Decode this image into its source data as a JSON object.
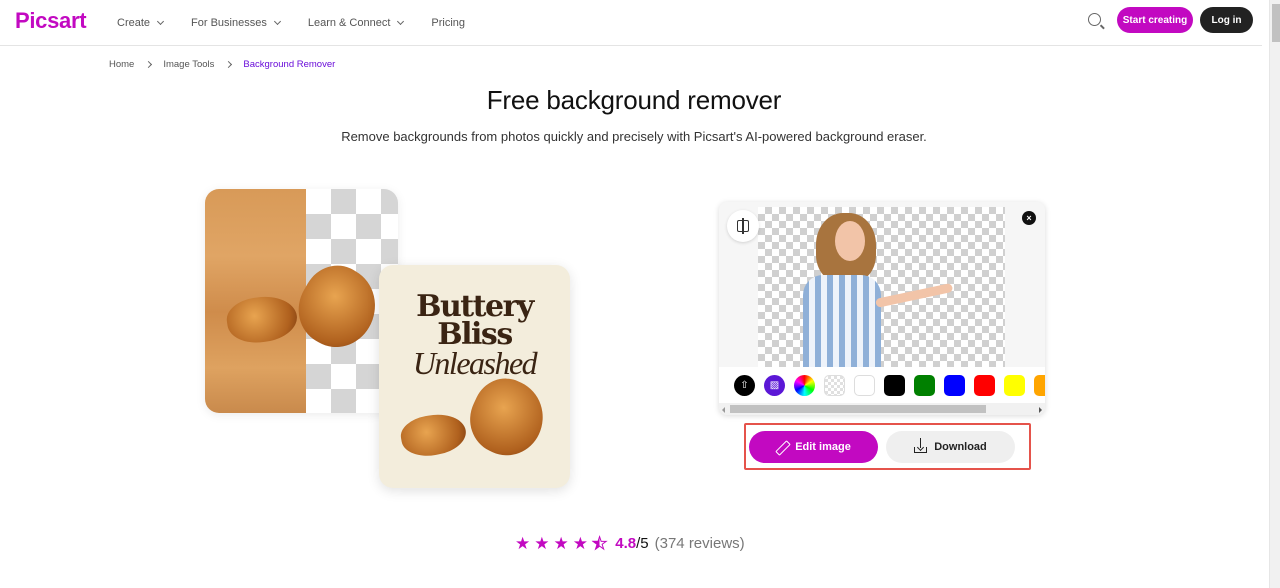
{
  "header": {
    "logo": "Picsart",
    "nav": [
      {
        "label": "Create",
        "has_dropdown": true
      },
      {
        "label": "For Businesses",
        "has_dropdown": true
      },
      {
        "label": "Learn & Connect",
        "has_dropdown": true
      },
      {
        "label": "Pricing",
        "has_dropdown": false
      }
    ],
    "search_icon": "search-icon",
    "start_creating_label": "Start creating",
    "login_label": "Log in"
  },
  "breadcrumb": [
    {
      "label": "Home"
    },
    {
      "label": "Image Tools"
    },
    {
      "label": "Background Remover",
      "current": true
    }
  ],
  "hero": {
    "title": "Free background remover",
    "subtitle": "Remove backgrounds from photos quickly and precisely with Picsart's AI-powered background eraser."
  },
  "illustration": {
    "poster_line1": "Buttery",
    "poster_line2": "Bliss",
    "poster_line3": "Unleashed"
  },
  "editor": {
    "compare_icon": "compare-icon",
    "close_icon": "close-icon",
    "close_glyph": "×",
    "swatches": [
      {
        "name": "upload",
        "type": "icon",
        "color": "#000000",
        "glyph": "⇧"
      },
      {
        "name": "ai-background",
        "type": "icon",
        "color": "#5b17d6",
        "glyph": "▨"
      },
      {
        "name": "custom-color",
        "type": "rainbow"
      },
      {
        "name": "transparent",
        "type": "transparent"
      },
      {
        "name": "white",
        "color": "#ffffff"
      },
      {
        "name": "black",
        "color": "#000000"
      },
      {
        "name": "green",
        "color": "#008000"
      },
      {
        "name": "blue",
        "color": "#0000ff"
      },
      {
        "name": "red",
        "color": "#ff0000"
      },
      {
        "name": "yellow",
        "color": "#ffff00"
      },
      {
        "name": "orange",
        "color": "#ffa500"
      }
    ],
    "scroll_position": 0
  },
  "actions": {
    "edit_label": "Edit image",
    "download_label": "Download"
  },
  "rating": {
    "stars": 4.5,
    "star_glyph": "★",
    "value": "4.8",
    "max": "/5",
    "count": "(374 reviews)"
  },
  "colors": {
    "brand": "#c209c1",
    "breadcrumb_current": "#6a0dd9",
    "highlight_box": "#e5534b"
  }
}
